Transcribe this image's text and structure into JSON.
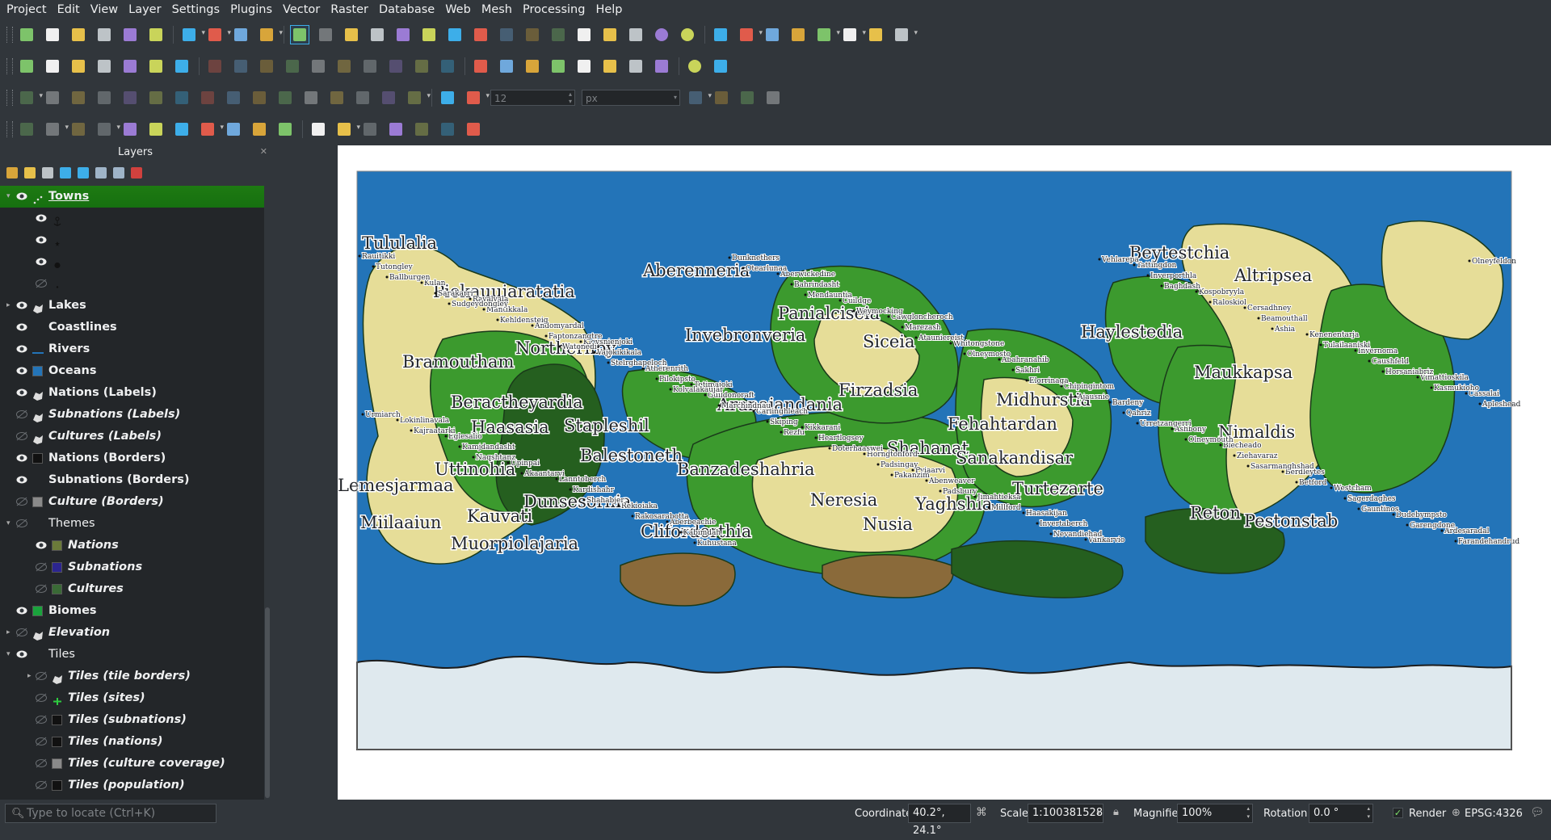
{
  "menu": [
    "Project",
    "Edit",
    "View",
    "Layer",
    "Settings",
    "Plugins",
    "Vector",
    "Raster",
    "Database",
    "Web",
    "Mesh",
    "Processing",
    "Help"
  ],
  "toolbar": {
    "snapping_tolerance_value": "12",
    "snapping_unit": "px"
  },
  "icons": {
    "row1": [
      "new-project-icon",
      "open-project-icon",
      "save-project-icon",
      "save-as-icon",
      "print-layout-icon",
      "style-manager-icon",
      "select-features-icon",
      "deselect-icon",
      "attribute-table-icon",
      "clear-selection-icon",
      "pan-map-icon",
      "pan-to-selection-icon",
      "zoom-in-icon",
      "zoom-out-icon",
      "zoom-full-icon",
      "zoom-to-selection-icon",
      "zoom-to-layer-icon",
      "zoom-native-icon",
      "zoom-last-icon",
      "zoom-next-icon",
      "new-map-view-icon",
      "new-3d-view-icon",
      "new-bookmark-icon",
      "show-bookmarks-icon",
      "temporal-controller-icon",
      "refresh-icon",
      "identify-icon",
      "open-field-calculator-icon",
      "processing-toolbox-icon",
      "statistical-summary-icon",
      "open-attribute-table-icon",
      "measure-icon",
      "map-tips-icon",
      "plugin-gear-icon"
    ],
    "row2": [
      "data-source-manager-icon",
      "new-geopackage-icon",
      "new-temp-layer-icon",
      "digitize-icon",
      "add-spatialite-icon",
      "add-vector-icon",
      "add-raster-icon",
      "toggle-editing-icon",
      "save-edits-icon",
      "add-point-icon",
      "vertex-tool-icon",
      "delete-selected-icon",
      "cut-features-icon",
      "copy-features-icon",
      "paste-features-icon",
      "undo-icon",
      "redo-icon",
      "label-toolbar-icon",
      "diagram-icon",
      "label-pin-icon",
      "label-highlight-icon",
      "label-show-hide-icon",
      "label-move-icon",
      "label-rotate-icon",
      "label-change-icon",
      "python-console-icon",
      "help-icon"
    ],
    "row3": [
      "advanced-digitizing-icon",
      "move-feature-icon",
      "rotate-feature-icon",
      "simplify-icon",
      "add-ring-icon",
      "add-part-icon",
      "fill-ring-icon",
      "delete-ring-icon",
      "delete-part-icon",
      "reshape-icon",
      "offset-curve-icon",
      "split-features-icon",
      "split-parts-icon",
      "merge-features-icon",
      "merge-attributes-icon",
      "rotate-point-symbols-icon",
      "snapping-magnet-icon",
      "snapping-mode-icon",
      "snapping-type-icon",
      "trace-icon",
      "topology-icon",
      "self-snap-icon"
    ],
    "row4": [
      "shape-digitizing-icon",
      "annotation-icon",
      "label-tool-icon",
      "select-by-location-icon",
      "select-by-radius-icon",
      "select-by-polygon-icon",
      "select-by-freehand-icon",
      "text-annotation-icon",
      "form-annotation-icon",
      "html-annotation-icon",
      "svg-annotation-icon",
      "georeferencer-icon",
      "locator-icon",
      "crosshair-icon",
      "add-grid-icon",
      "vertex-editor-icon",
      "about-info-icon",
      "plugin-wrench-icon"
    ]
  },
  "layers_panel": {
    "title": "Layers",
    "layers": [
      {
        "name": "Towns",
        "visible": true,
        "indent": 0,
        "expand": "▾",
        "icon": "point-layer-icon",
        "italic": false,
        "selected": true
      },
      {
        "name": "",
        "visible": true,
        "indent": 1,
        "expand": "",
        "icon": "anchor-symbol-icon",
        "italic": false,
        "selected": false
      },
      {
        "name": "",
        "visible": true,
        "indent": 1,
        "expand": "",
        "icon": "star-symbol-icon",
        "italic": false,
        "selected": false
      },
      {
        "name": "",
        "visible": true,
        "indent": 1,
        "expand": "",
        "icon": "circle-symbol-icon",
        "italic": false,
        "selected": false
      },
      {
        "name": "",
        "visible": false,
        "indent": 1,
        "expand": "",
        "icon": "dot-symbol-icon",
        "italic": false,
        "selected": false
      },
      {
        "name": "Lakes",
        "visible": true,
        "indent": 0,
        "expand": "▸",
        "icon": "polygon-layer-icon",
        "italic": false,
        "selected": false
      },
      {
        "name": "Coastlines",
        "visible": true,
        "indent": 0,
        "expand": "",
        "icon": "",
        "italic": false,
        "selected": false
      },
      {
        "name": "Rivers",
        "visible": true,
        "indent": 0,
        "expand": "",
        "icon": "line-layer-icon",
        "italic": false,
        "selected": false
      },
      {
        "name": "Oceans",
        "visible": true,
        "indent": 0,
        "expand": "",
        "icon": "blue-fill-icon",
        "italic": false,
        "selected": false
      },
      {
        "name": "Nations (Labels)",
        "visible": true,
        "indent": 0,
        "expand": "",
        "icon": "polygon-layer-icon",
        "italic": false,
        "selected": false
      },
      {
        "name": "Subnations (Labels)",
        "visible": false,
        "indent": 0,
        "expand": "",
        "icon": "polygon-layer-icon",
        "italic": true,
        "selected": false
      },
      {
        "name": "Cultures (Labels)",
        "visible": false,
        "indent": 0,
        "expand": "",
        "icon": "polygon-layer-icon",
        "italic": true,
        "selected": false
      },
      {
        "name": "Nations (Borders)",
        "visible": true,
        "indent": 0,
        "expand": "",
        "icon": "black-fill-icon",
        "italic": false,
        "selected": false
      },
      {
        "name": "Subnations (Borders)",
        "visible": true,
        "indent": 0,
        "expand": "",
        "icon": "",
        "italic": false,
        "selected": false
      },
      {
        "name": "Culture (Borders)",
        "visible": false,
        "indent": 0,
        "expand": "",
        "icon": "grey-fill-icon",
        "italic": true,
        "selected": false
      },
      {
        "name": "Themes",
        "visible": false,
        "indent": 0,
        "expand": "▾",
        "icon": "",
        "italic": false,
        "selected": false,
        "group": true
      },
      {
        "name": "Nations",
        "visible": true,
        "indent": 1,
        "expand": "",
        "icon": "olive-fill-icon",
        "italic": true,
        "selected": false
      },
      {
        "name": "Subnations",
        "visible": false,
        "indent": 1,
        "expand": "",
        "icon": "purple-fill-icon",
        "italic": true,
        "selected": false
      },
      {
        "name": "Cultures",
        "visible": false,
        "indent": 1,
        "expand": "",
        "icon": "darkgreen-fill-icon",
        "italic": true,
        "selected": false
      },
      {
        "name": "Biomes",
        "visible": true,
        "indent": 0,
        "expand": "",
        "icon": "green-fill-icon",
        "italic": false,
        "selected": false
      },
      {
        "name": "Elevation",
        "visible": false,
        "indent": 0,
        "expand": "▸",
        "icon": "polygon-layer-icon",
        "italic": true,
        "selected": false
      },
      {
        "name": "Tiles",
        "visible": true,
        "indent": 0,
        "expand": "▾",
        "icon": "",
        "italic": false,
        "selected": false,
        "group": true
      },
      {
        "name": "Tiles (tile borders)",
        "visible": false,
        "indent": 1,
        "expand": "▸",
        "icon": "polygon-layer-icon",
        "italic": true,
        "selected": false
      },
      {
        "name": "Tiles (sites)",
        "visible": false,
        "indent": 1,
        "expand": "",
        "icon": "plus-symbol-icon",
        "italic": true,
        "selected": false
      },
      {
        "name": "Tiles (subnations)",
        "visible": false,
        "indent": 1,
        "expand": "",
        "icon": "black-fill-icon",
        "italic": true,
        "selected": false
      },
      {
        "name": "Tiles (nations)",
        "visible": false,
        "indent": 1,
        "expand": "",
        "icon": "black-fill-icon",
        "italic": true,
        "selected": false
      },
      {
        "name": "Tiles (culture coverage)",
        "visible": false,
        "indent": 1,
        "expand": "",
        "icon": "grey-fill-icon",
        "italic": true,
        "selected": false
      },
      {
        "name": "Tiles (population)",
        "visible": false,
        "indent": 1,
        "expand": "",
        "icon": "black-fill-icon",
        "italic": true,
        "selected": false
      }
    ]
  },
  "map": {
    "nations": [
      "Tululalia",
      "Aberenneria",
      "Piekauujaratatia",
      "Beytestchia",
      "Altripsea",
      "Panialciseia",
      "Invebronveria",
      "Siceia",
      "Haylestedia",
      "Northernby",
      "Bramoutham",
      "Aranajandania",
      "Firzadsia",
      "Midhurstia",
      "Maukkapsa",
      "Beractheyardia",
      "Haasasia",
      "Stapleshil",
      "Fehahtardan",
      "Nimaldis",
      "Balestoneth",
      "Shahanat",
      "Sanakandisar",
      "Uttinohia",
      "Banzadeshahria",
      "Lemesjarmaa",
      "Dunsesornia",
      "Neresia",
      "Yaghshia",
      "Turtezarte",
      "Reton",
      "Kauvati",
      "Pestonstab",
      "Miilaaiun",
      "Nusia",
      "Clifordorthia",
      "Muorpiolajaria"
    ],
    "towns": [
      "Rauitikki",
      "Ravalvala",
      "Klovsnienjoki",
      "Totimajoki",
      "Kikkarani",
      "Pyiaarvi",
      "Haasakijan",
      "Tattingdon",
      "Cersadhney",
      "Invernoma",
      "Cassalai",
      "Eglesalio",
      "Lanntoberch",
      "Aberbeachie",
      "Aberwickedine",
      "Cawgloncheroch",
      "Abahranahib",
      "Bardeny",
      "Blecheado",
      "Westcham",
      "Ardesaradal",
      "Kulan",
      "Andomyardal",
      "Atherenrith",
      "Carlinghleach",
      "Horngtonford",
      "Jimahtieksa",
      "Vankarvio",
      "Kospobryyla",
      "Kenenentarja",
      "Vimattioskila",
      "Lokinlinavala",
      "Upinpai",
      "Rekioiaka",
      "Dunknethers",
      "Cuildge",
      "Whitongstone",
      "Chipingintom",
      "Ashbony",
      "Berdleytes",
      "Dudebympsto",
      "Tutongley",
      "Mantikkala",
      "Vajokikikala",
      "Guildonoraft",
      "Heartlogsey",
      "Abenweaver",
      "Invertaberch",
      "Inverporthla",
      "Beamouthall",
      "Caushfeld",
      "Apleshead",
      "Kamjdandasht",
      "Kardishahr",
      "Kabimdah",
      "Bahrindasht",
      "Marezash",
      "Sakhri",
      "Qahriz",
      "Ziehavaraz",
      "Sagerdaghes",
      "Farandehandrud",
      "Sarakarri",
      "Faptonzangtre",
      "Pilokipsto",
      "Skiping",
      "Padsingay",
      "Millford",
      "Vehlarepa",
      "Raloskiol",
      "Tulailaaniski",
      "Kasmukioho",
      "Kajraatarki",
      "Akaantarvi",
      "Rakosarabotta",
      "Otearlunaa",
      "Weymocking",
      "Olneymosto",
      "Ajausnie",
      "Olneymouth",
      "Betford",
      "Garengdone",
      "Ballburgen",
      "Kehldensteig",
      "Stelrghapeloch",
      "Marchindnau",
      "Doterhaaswei",
      "Padsbury",
      "Nevandiehad",
      "Baghdash",
      "Ashia",
      "Horsaniabriz",
      "Urmiarch",
      "Naqshtanz",
      "Shahabjer",
      "Kuhustana",
      "Mendauntia",
      "Atauniereist",
      "Elorrinaga",
      "Urretzangerri",
      "Sasarmanghshad",
      "Gauntinos",
      "Olneyfeldon",
      "Sudgeydongley",
      "Watonedi",
      "Kolvalakaujar",
      "Rezfu",
      "Pakanzim"
    ],
    "colors": {
      "ocean": "#2374b8",
      "land_light": "#e6dd98",
      "land_green": "#3c9a2e",
      "land_dark": "#255f1f",
      "ice": "#dfe9ee",
      "brown": "#8a6a3a"
    }
  },
  "status": {
    "locator_placeholder": "Type to locate (Ctrl+K)",
    "coordinate_label": "Coordinate",
    "coordinate_value": "40.2°, 24.1°",
    "scale_label": "Scale",
    "scale_value": "1:100381528",
    "magnifier_label": "Magnifier",
    "magnifier_value": "100%",
    "rotation_label": "Rotation",
    "rotation_value": "0.0 °",
    "render_label": "Render",
    "crs_value": "EPSG:4326"
  }
}
